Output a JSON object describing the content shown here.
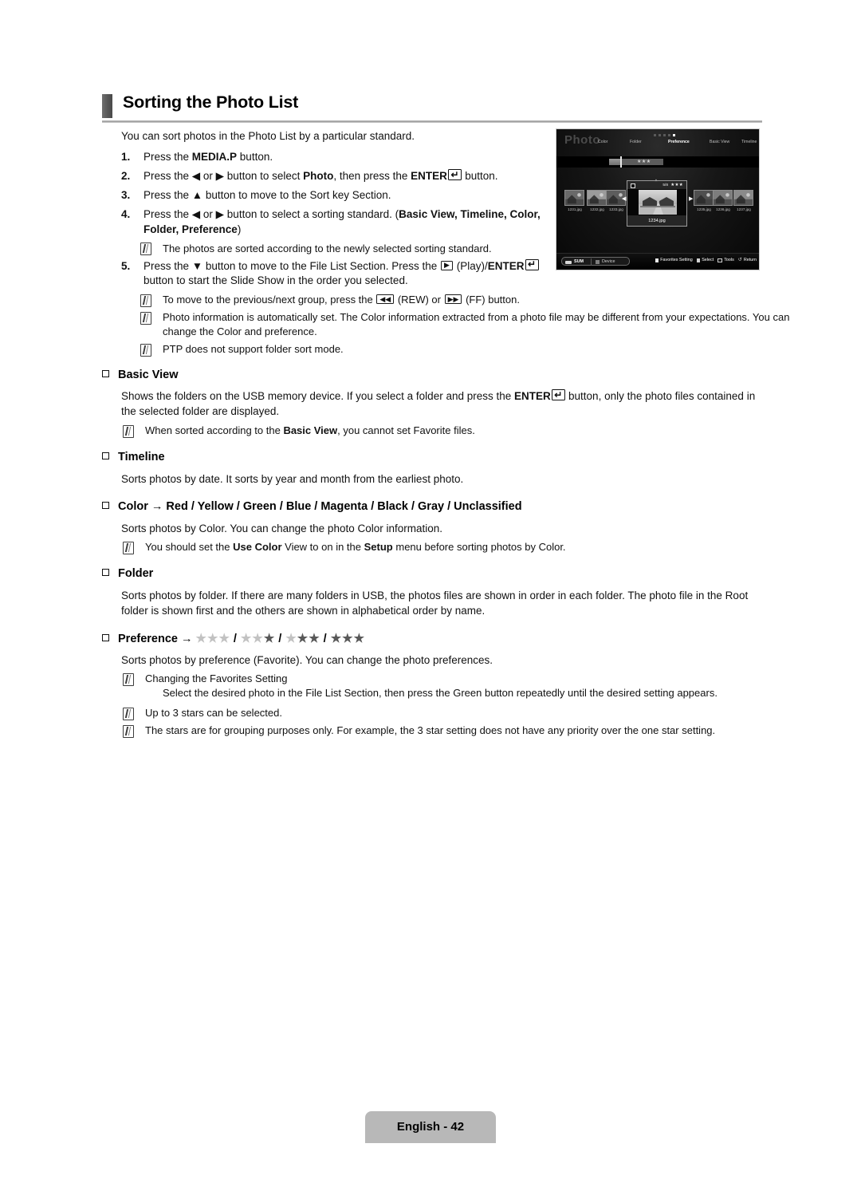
{
  "page": {
    "title": "Sorting the Photo List",
    "intro": "You can sort photos in the Photo List by a particular standard.",
    "footer_label": "English - 42"
  },
  "steps": [
    {
      "num": "1.",
      "text_before": "Press the ",
      "bold1": "MEDIA.P",
      "text_after": " button."
    },
    {
      "num": "2.",
      "text_before": "Press the ◀ or ▶ button to select ",
      "bold1": "Photo",
      "text_mid": ", then press the ",
      "bold2": "ENTER",
      "text_after": " button."
    },
    {
      "num": "3.",
      "text_before": "Press the ▲ button to move to the Sort key Section."
    },
    {
      "num": "4.",
      "text_before": "Press the ◀ or ▶ button to select a sorting standard. (",
      "bold1": "Basic View, Timeline, Color, Folder, Preference",
      "text_after": ")"
    },
    {
      "num": "5.",
      "text_before": "Press the ▼ button to move to the File List Section. Press the ",
      "play_icon": "play-icon",
      "text_mid": " (Play)/",
      "bold2": "ENTER",
      "text_after": " button to start the Slide Show in the order you selected."
    }
  ],
  "notes": {
    "after_step4": "The photos are sorted according to the newly selected sorting standard.",
    "after_step5_1_a": "To move to the previous/next group, press the ",
    "after_step5_1_b": " (REW) or ",
    "after_step5_1_c": " (FF) button.",
    "after_step5_2": "Photo information is automatically set. The Color information extracted from a photo file may be different from your expectations. You can change the Color and preference.",
    "after_step5_3": "PTP does not support folder sort mode."
  },
  "sections": [
    {
      "heading": "Basic View",
      "body_a": "Shows the folders on the USB memory device. If you select a folder and press the ",
      "body_bold": "ENTER",
      "body_b": " button, only the photo files contained in the selected folder are displayed.",
      "note_a": "When sorted according to the ",
      "note_bold": "Basic View",
      "note_b": ", you cannot set Favorite files."
    },
    {
      "heading": "Timeline",
      "body": "Sorts photos by date. It sorts by year and month from the earliest photo."
    },
    {
      "heading_a": "Color",
      "heading_arrow": " → ",
      "heading_b": "Red / Yellow / Green / Blue / Magenta / Black / Gray / Unclassified",
      "body": "Sorts photos by Color. You can change the photo Color information.",
      "note_a": "You should set the ",
      "note_bold1": "Use Color",
      "note_mid": " View to on in the ",
      "note_bold2": "Setup",
      "note_b": " menu before sorting photos by Color."
    },
    {
      "heading": "Folder",
      "body": "Sorts photos by folder. If there are many folders in USB, the photos files are shown in order in each folder. The photo file in the Root folder is shown first and the others are shown in alphabetical order by name."
    },
    {
      "heading": "Preference",
      "heading_arrow": " → ",
      "stars_groups": [
        0,
        1,
        2,
        3
      ],
      "stars_per_group": 3,
      "body": "Sorts photos by preference (Favorite). You can change the photo preferences.",
      "note1": "Changing the Favorites Setting",
      "note1_sub": "Select the desired photo in the File List Section, then press the Green button repeatedly until the desired setting appears.",
      "note2": "Up to 3 stars can be selected.",
      "note3": "The stars are for grouping purposes only. For example, the 3 star setting does not have any priority over the one star setting."
    }
  ],
  "tv_screenshot": {
    "title": "Photo",
    "menu": [
      "Color",
      "Folder",
      "Preference",
      "Basic View",
      "Timeline"
    ],
    "menu_selected": "Preference",
    "slider_stars": "★★★",
    "thumbnails": [
      {
        "label": "1231.jpg"
      },
      {
        "label": "1232.jpg"
      },
      {
        "label": "1233.jpg"
      },
      {
        "label": "1235.jpg"
      },
      {
        "label": "1236.jpg"
      },
      {
        "label": "1237.jpg"
      }
    ],
    "selected": {
      "name": "1234.jpg",
      "count": "5/8",
      "stars": "★★★"
    },
    "bottom_left": {
      "device_name": "SUM",
      "device_label": "Device"
    },
    "bottom_actions": [
      {
        "label": "Favorites Setting",
        "color": "#e9e9e9"
      },
      {
        "label": "Select",
        "color": "#d2d2d2"
      },
      {
        "label": "Tools",
        "color": ""
      },
      {
        "label": "Return",
        "color": ""
      }
    ]
  },
  "colors": {
    "title_bar": "#9d9d9d",
    "footer_bg": "#b8b8b8",
    "star_on": "#595959",
    "star_off": "#c2c2c2",
    "tv_bg": "#000000"
  }
}
